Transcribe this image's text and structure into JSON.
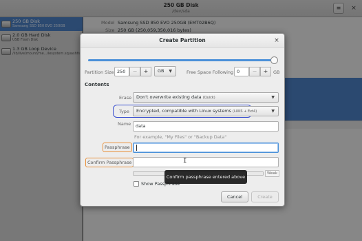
{
  "window": {
    "title": "250 GB Disk",
    "subtitle": "/dev/sda",
    "menu_icon": "hamburger-menu-icon",
    "close_glyph": "×"
  },
  "sidebar": {
    "devices": [
      {
        "name": "250 GB Disk",
        "desc": "Samsung SSD 850 EVO 250GB",
        "selected": true
      },
      {
        "name": "2.0 GB Hard Disk",
        "desc": "USB Flash Disk",
        "selected": false
      },
      {
        "name": "1.3 GB Loop Device",
        "desc": "/lib/live/mount/me...ilesystem.squashfs",
        "selected": false
      }
    ]
  },
  "main": {
    "model_label": "Model",
    "model_value": "Samsung SSD 850 EVO 250GB (EMT02B6Q)",
    "size_label": "Size",
    "size_value": "250 GB (250,059,350,016 bytes)"
  },
  "dialog": {
    "title": "Create Partition",
    "close_glyph": "×",
    "partition_size_label": "Partition Size",
    "partition_size_value": "250",
    "minus": "−",
    "plus": "+",
    "size_unit": "GB",
    "free_space_label": "Free Space Following",
    "free_space_value": "0",
    "free_space_unit": "GB",
    "contents_heading": "Contents",
    "erase_label": "Erase",
    "erase_value": "Don't overwrite existing data",
    "erase_note": "(Quick)",
    "type_label": "Type",
    "type_value": "Encrypted, compatible with Linux systems",
    "type_note": "(LUKS + Ext4)",
    "name_label": "Name",
    "name_value": "data",
    "name_hint": "For example, \"My Files\" or \"Backup Data\"",
    "passphrase_label": "Passphrase",
    "passphrase_value": "",
    "confirm_label": "Confirm Passphrase",
    "confirm_value": "",
    "strength_label": "Weak",
    "show_passphrase_label": "Show Passphrase",
    "cancel_label": "Cancel",
    "create_label": "Create",
    "tooltip": "Confirm passphrase entered above",
    "slider_fraction": 1.0
  },
  "colors": {
    "accent": "#4a90d9",
    "selection": "#4a7fc1",
    "annotation_blue": "#3a50d0",
    "annotation_orange": "#e8903a"
  }
}
